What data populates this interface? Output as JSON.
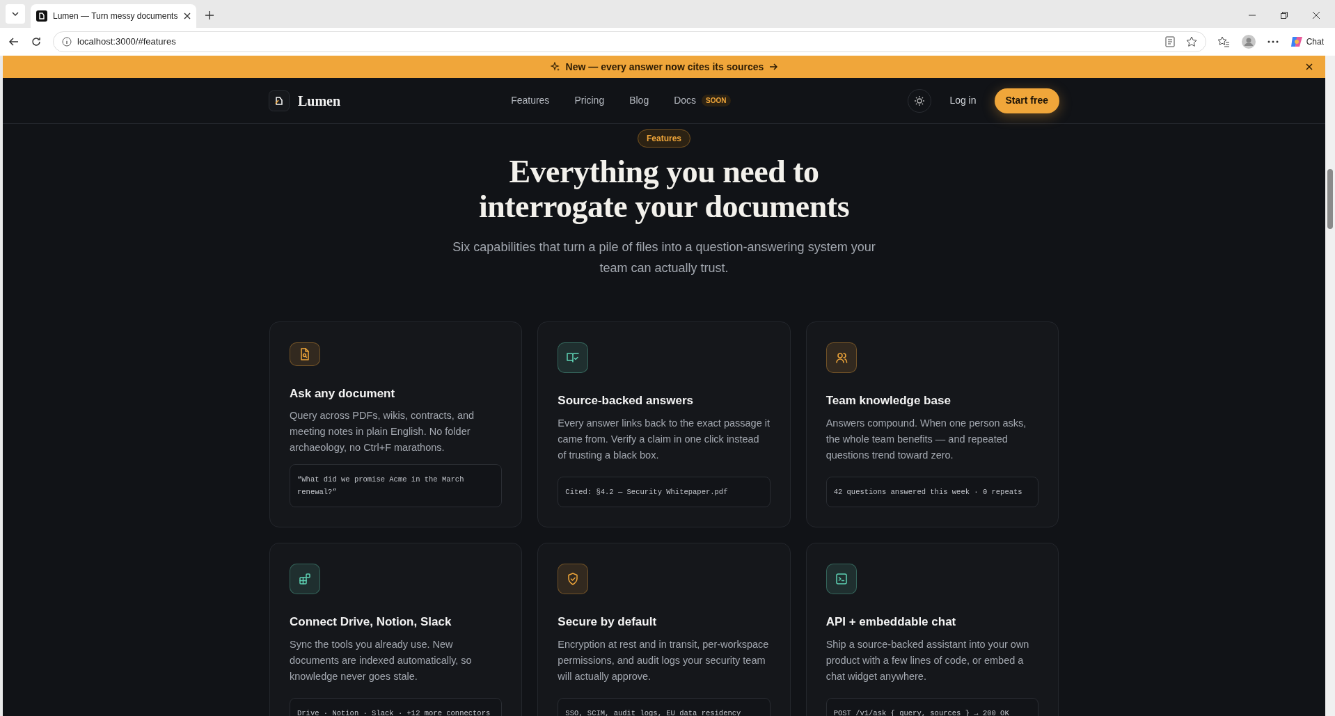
{
  "browser": {
    "tab_title": "Lumen — Turn messy documents",
    "url": "localhost:3000/#features",
    "chat_label": "Chat"
  },
  "banner": {
    "text": "New — every answer now cites its sources"
  },
  "nav": {
    "brand": "Lumen",
    "links": [
      {
        "label": "Features"
      },
      {
        "label": "Pricing"
      },
      {
        "label": "Blog"
      },
      {
        "label": "Docs",
        "badge": "SOON"
      }
    ],
    "login": "Log in",
    "cta": "Start free"
  },
  "hero": {
    "eyebrow": "Features",
    "title": "Everything you need to interrogate your documents",
    "subtitle": "Six capabilities that turn a pile of files into a question-answering system your team can actually trust."
  },
  "features": [
    {
      "kind": "document",
      "color": "#f0a63a",
      "title": "Ask any document",
      "text": "Query across PDFs, wikis, contracts, and meeting notes in plain English. No folder archaeology, no Ctrl+F marathons.",
      "snippet": "“What did we promise Acme in the March renewal?”"
    },
    {
      "kind": "book",
      "color": "#5fd3b5",
      "title": "Source-backed answers",
      "text": "Every answer links back to the exact passage it came from. Verify a claim in one click instead of trusting a black box.",
      "snippet": "Cited: §4.2 — Security Whitepaper.pdf"
    },
    {
      "kind": "users",
      "color": "#f0a63a",
      "title": "Team knowledge base",
      "text": "Answers compound. When one person asks, the whole team benefits — and repeated questions trend toward zero.",
      "snippet": "42 questions answered this week · 0 repeats"
    },
    {
      "kind": "blocks",
      "color": "#5fd3b5",
      "title": "Connect Drive, Notion, Slack",
      "text": "Sync the tools you already use. New documents are indexed automatically, so knowledge never goes stale.",
      "snippet": "Drive · Notion · Slack · +12 more connectors"
    },
    {
      "kind": "shield",
      "color": "#f0a63a",
      "title": "Secure by default",
      "text": "Encryption at rest and in transit, per-workspace permissions, and audit logs your security team will actually approve.",
      "snippet": "SSO, SCIM, audit logs, EU data residency"
    },
    {
      "kind": "terminal",
      "color": "#5fd3b5",
      "title": "API + embeddable chat",
      "text": "Ship a source-backed assistant into your own product with a few lines of code, or embed a chat widget anywhere.",
      "snippet": "POST /v1/ask { query, sources } → 200 OK"
    }
  ]
}
